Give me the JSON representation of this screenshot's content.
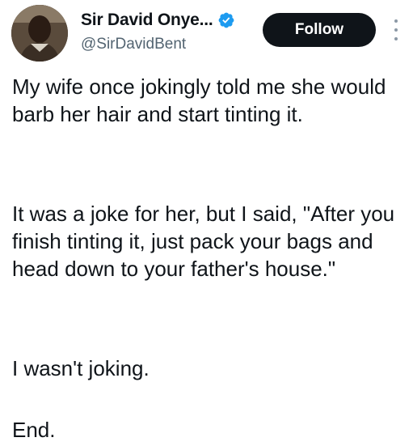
{
  "author": {
    "display_name": "Sir David Onye...",
    "handle": "@SirDavidBent",
    "verified": true,
    "avatar_icon": "profile-photo",
    "verified_icon": "verified-badge-icon",
    "verified_color": "#1d9bf0"
  },
  "actions": {
    "follow_label": "Follow",
    "more_icon": "more-vertical-icon"
  },
  "tweet": {
    "paragraphs": [
      "My wife once jokingly told me she would barb her hair and start tinting it.",
      "It was a joke for her, but I said, \"After you finish tinting it, just pack your bags and head down to your father's house.\"",
      "I wasn't joking.",
      "End."
    ]
  },
  "colors": {
    "text_primary": "#0f1419",
    "text_secondary": "#536471",
    "button_bg": "#0f1419",
    "button_text": "#ffffff"
  }
}
